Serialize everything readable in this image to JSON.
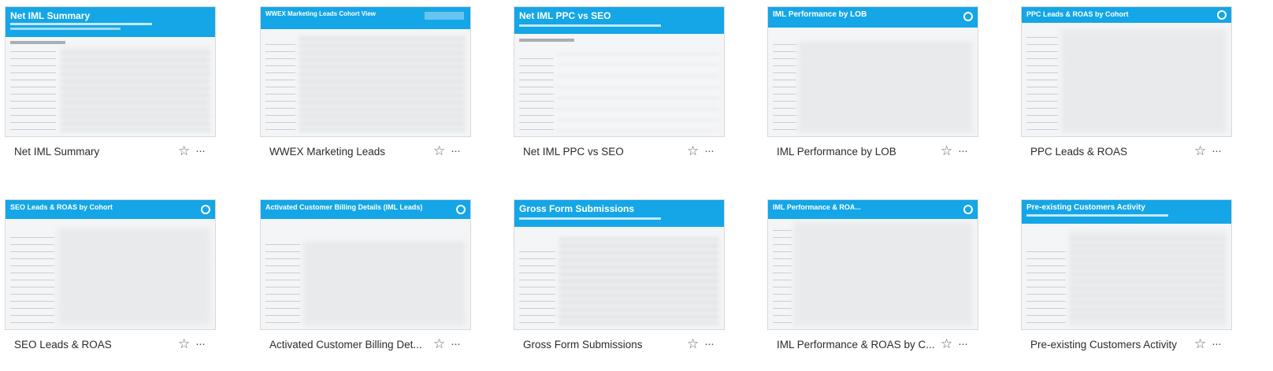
{
  "brand": {
    "banner_color": "#14a6e6"
  },
  "cards": [
    {
      "title": "Net IML Summary",
      "thumb_title": "Net IML Summary"
    },
    {
      "title": "WWEX Marketing Leads",
      "thumb_title": "WWEX Marketing Leads Cohort View"
    },
    {
      "title": "Net IML PPC vs SEO",
      "thumb_title": "Net IML PPC vs SEO"
    },
    {
      "title": "IML Performance by LOB",
      "thumb_title": "IML Performance by LOB"
    },
    {
      "title": "PPC Leads & ROAS",
      "thumb_title": "PPC Leads & ROAS by Cohort"
    },
    {
      "title": "SEO Leads & ROAS",
      "thumb_title": "SEO Leads & ROAS by Cohort"
    },
    {
      "title": "Activated Customer Billing Det...",
      "thumb_title": "Activated Customer Billing Details (IML Leads)"
    },
    {
      "title": "Gross Form Submissions",
      "thumb_title": "Gross Form Submissions"
    },
    {
      "title": "IML Performance & ROAS by C...",
      "thumb_title": "IML Performance & ROA..."
    },
    {
      "title": "Pre-existing Customers Activity",
      "thumb_title": "Pre-existing Customers Activity"
    }
  ],
  "icons": {
    "favorite": "star-outline-icon",
    "more": "more-dots-icon"
  },
  "more_glyph": "···",
  "star_glyph": "☆"
}
